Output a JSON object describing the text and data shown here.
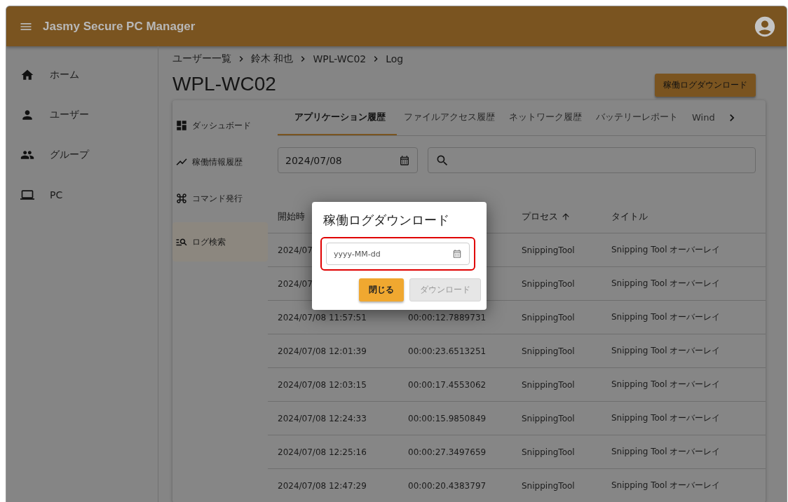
{
  "app_bar": {
    "title": "Jasmy Secure PC Manager"
  },
  "nav": [
    {
      "label": "ホーム"
    },
    {
      "label": "ユーザー"
    },
    {
      "label": "グループ"
    },
    {
      "label": "PC"
    }
  ],
  "breadcrumb": [
    "ユーザー一覧",
    "鈴木 和也",
    "WPL-WC02",
    "Log"
  ],
  "page_title": "WPL-WC02",
  "download_button": "稼働ログダウンロード",
  "side_menu": [
    {
      "label": "ダッシュボード",
      "selected": false
    },
    {
      "label": "稼働情報履歴",
      "selected": false
    },
    {
      "label": "コマンド発行",
      "selected": false
    },
    {
      "label": "ログ検索",
      "selected": true
    }
  ],
  "tabs": [
    {
      "label": "アプリケーション履歴",
      "selected": true
    },
    {
      "label": "ファイルアクセス履歴",
      "selected": false
    },
    {
      "label": "ネットワーク履歴",
      "selected": false
    },
    {
      "label": "バッテリーレポート",
      "selected": false
    },
    {
      "label": "Wind",
      "selected": false
    }
  ],
  "date_field": {
    "value": "2024/07/08"
  },
  "table": {
    "columns": [
      {
        "label": "開始時"
      },
      {},
      {
        "label": "プロセス",
        "sorted": true
      },
      {
        "label": "タイトル"
      }
    ],
    "rows": [
      {
        "start": "2024/07",
        "process": "SnippingTool",
        "title": "Snipping Tool オーバーレイ"
      },
      {
        "start": "2024/07",
        "process": "SnippingTool",
        "title": "Snipping Tool オーバーレイ"
      },
      {
        "start": "2024/07/08 11:57:51",
        "duration": "00:00:12.7889731",
        "process": "SnippingTool",
        "title": "Snipping Tool オーバーレイ"
      },
      {
        "start": "2024/07/08 12:01:39",
        "duration": "00:00:23.6513251",
        "process": "SnippingTool",
        "title": "Snipping Tool オーバーレイ"
      },
      {
        "start": "2024/07/08 12:03:15",
        "duration": "00:00:17.4553062",
        "process": "SnippingTool",
        "title": "Snipping Tool オーバーレイ"
      },
      {
        "start": "2024/07/08 12:24:33",
        "duration": "00:00:15.9850849",
        "process": "SnippingTool",
        "title": "Snipping Tool オーバーレイ"
      },
      {
        "start": "2024/07/08 12:25:16",
        "duration": "00:00:27.3497659",
        "process": "SnippingTool",
        "title": "Snipping Tool オーバーレイ"
      },
      {
        "start": "2024/07/08 12:47:29",
        "duration": "00:00:20.4383797",
        "process": "SnippingTool",
        "title": "Snipping Tool オーバーレイ"
      }
    ]
  },
  "dialog": {
    "title": "稼働ログダウンロード",
    "date_field": {
      "placeholder": "yyyy-MM-dd"
    },
    "highlighted": true,
    "buttons": [
      {
        "label": "閉じる",
        "kind": "primary",
        "disabled": false
      },
      {
        "label": "ダウンロード",
        "kind": "secondary",
        "disabled": true
      }
    ]
  }
}
